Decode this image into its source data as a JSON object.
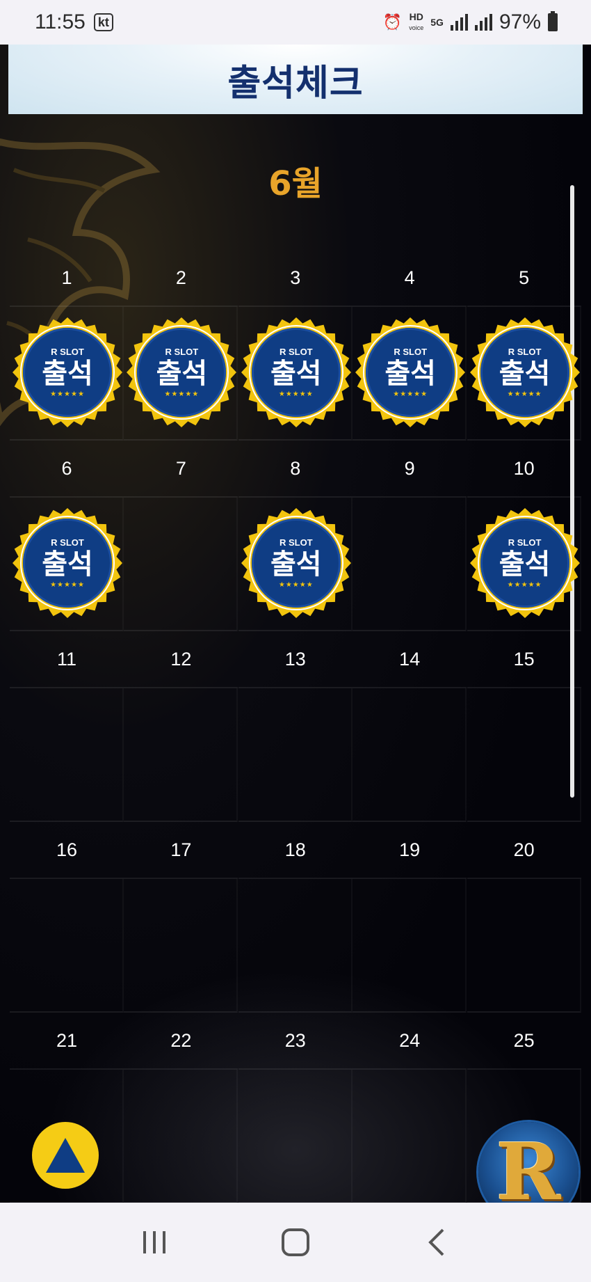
{
  "status_bar": {
    "time": "11:55",
    "carrier": "kt",
    "hd_label": "HD",
    "voice_label": "voice",
    "net_label": "5G",
    "battery": "97%"
  },
  "header": {
    "title": "출석체크"
  },
  "calendar": {
    "month": "6월",
    "stamp": {
      "brand": "R SLOT",
      "text": "출석",
      "stars": "★★★★★"
    },
    "days": [
      {
        "day": "1",
        "checked": true
      },
      {
        "day": "2",
        "checked": true
      },
      {
        "day": "3",
        "checked": true
      },
      {
        "day": "4",
        "checked": true
      },
      {
        "day": "5",
        "checked": true
      },
      {
        "day": "6",
        "checked": true
      },
      {
        "day": "7",
        "checked": false
      },
      {
        "day": "8",
        "checked": true
      },
      {
        "day": "9",
        "checked": false
      },
      {
        "day": "10",
        "checked": true
      },
      {
        "day": "11",
        "checked": false
      },
      {
        "day": "12",
        "checked": false
      },
      {
        "day": "13",
        "checked": false
      },
      {
        "day": "14",
        "checked": false
      },
      {
        "day": "15",
        "checked": false
      },
      {
        "day": "16",
        "checked": false
      },
      {
        "day": "17",
        "checked": false
      },
      {
        "day": "18",
        "checked": false
      },
      {
        "day": "19",
        "checked": false
      },
      {
        "day": "20",
        "checked": false
      },
      {
        "day": "21",
        "checked": false
      },
      {
        "day": "22",
        "checked": false
      },
      {
        "day": "23",
        "checked": false
      },
      {
        "day": "24",
        "checked": false
      },
      {
        "day": "25",
        "checked": false
      }
    ]
  },
  "floating": {
    "r_logo_letter": "R"
  },
  "colors": {
    "header_title": "#14306e",
    "month": "#e8a42a",
    "stamp_blue": "#0f3d84",
    "stamp_gold": "#f2c40e",
    "top_button": "#f5cc15"
  },
  "icons": {
    "alarm": "alarm-icon",
    "signal": "signal-icon",
    "battery": "battery-icon",
    "back_to_top": "triangle-up-icon",
    "recents": "recents-icon",
    "home": "home-icon",
    "back": "back-icon"
  }
}
